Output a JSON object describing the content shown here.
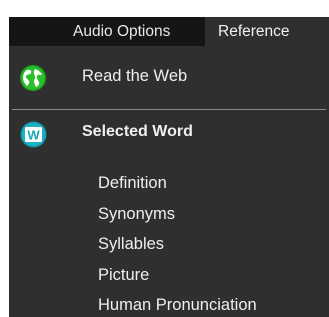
{
  "menubar": {
    "items": [
      {
        "label": "Audio Options"
      },
      {
        "label": "Reference"
      }
    ],
    "active_index": 1
  },
  "dropdown": {
    "web": {
      "label": "Read the Web",
      "icon": "globe-icon",
      "icon_color": "#2bbf2b"
    },
    "selected_word": {
      "label": "Selected Word",
      "icon": "word-w-icon",
      "icon_color": "#19a7b8",
      "icon_letter": "W",
      "subitems": [
        {
          "label": "Definition"
        },
        {
          "label": "Synonyms"
        },
        {
          "label": "Syllables"
        },
        {
          "label": "Picture"
        },
        {
          "label": "Human Pronunciation"
        }
      ]
    }
  },
  "colors": {
    "menubar_bg": "#151515",
    "menu_bg": "#2f2f2f",
    "text": "#efefef",
    "divider": "#8a8a8a"
  }
}
